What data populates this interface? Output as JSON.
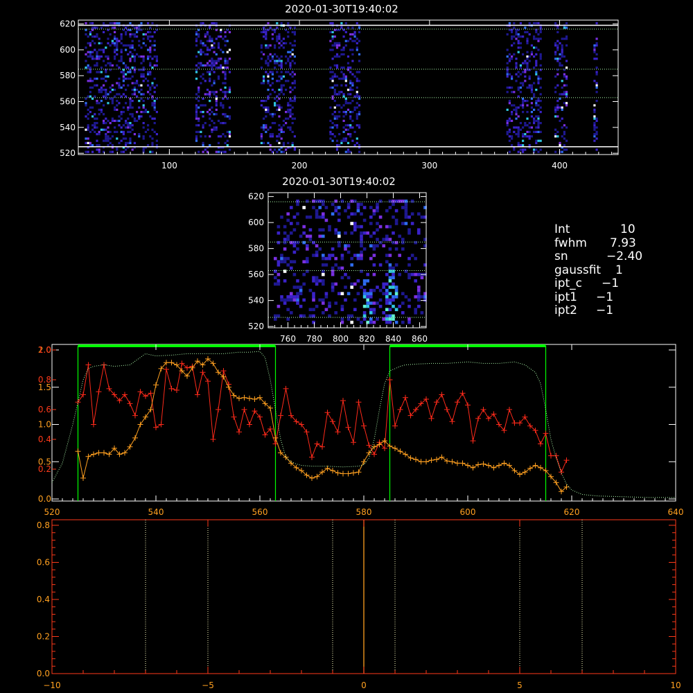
{
  "colors": {
    "background": "#000000",
    "axis_white": "#ffffff",
    "red_series": "#ff2a1a",
    "orange_series": "#ffa020",
    "green_box": "#00ff00",
    "dotted_profile": "#b0ffb0",
    "axis_red": "#ff3a1a",
    "axis_orange": "#ffa020",
    "vline_dotted": "#ffffc0",
    "center_line": "#ffa020"
  },
  "info": {
    "rows": [
      {
        "key": "Int",
        "value": "10"
      },
      {
        "key": "fwhm",
        "value": "7.93"
      },
      {
        "key": "sn",
        "value": "−2.40"
      },
      {
        "key": "gaussfit",
        "value": "1"
      },
      {
        "key": "ipt_c",
        "value": "−1"
      },
      {
        "key": "ipt1",
        "value": "−1"
      },
      {
        "key": "ipt2",
        "value": "−1"
      }
    ]
  },
  "chart_data": [
    {
      "type": "heatmap",
      "title": "2020-01-30T19:40:02",
      "xlim": [
        30,
        445
      ],
      "ylim": [
        519,
        623
      ],
      "x_ticks": [
        "100",
        "200",
        "300",
        "400"
      ],
      "x_tick_values": [
        100,
        200,
        300,
        400
      ],
      "y_ticks": [
        "520",
        "540",
        "560",
        "580",
        "600",
        "620"
      ],
      "y_tick_values": [
        520,
        540,
        560,
        580,
        600,
        620
      ],
      "horizontal_solid_lines": [
        525,
        619
      ],
      "horizontal_dotted_lines": [
        563,
        585,
        616
      ],
      "bright_bands_x": [
        [
          35,
          90
        ],
        [
          120,
          147
        ],
        [
          170,
          196
        ],
        [
          223,
          246
        ],
        [
          359,
          386
        ],
        [
          396,
          406
        ],
        [
          426,
          429
        ]
      ],
      "colormap": [
        "#1e1890",
        "#3a22c8",
        "#5a2ad8",
        "#7a30e0",
        "#2f6cf0",
        "#30c8e0",
        "#60f0d0",
        "#ffffff"
      ]
    },
    {
      "type": "heatmap",
      "title": "2020-01-30T19:40:02",
      "xlim": [
        745,
        865
      ],
      "ylim": [
        519,
        623
      ],
      "x_ticks": [
        "760",
        "780",
        "800",
        "820",
        "840",
        "860"
      ],
      "x_tick_values": [
        760,
        780,
        800,
        820,
        840,
        860
      ],
      "y_ticks": [
        "520",
        "540",
        "560",
        "580",
        "600",
        "620"
      ],
      "y_tick_values": [
        520,
        540,
        560,
        580,
        600,
        620
      ],
      "horizontal_dotted_lines": [
        527,
        563,
        585,
        616
      ],
      "bright_columns_x": [
        [
          815,
          822
        ],
        [
          833,
          842
        ]
      ],
      "colormap": [
        "#1e1890",
        "#3a22c8",
        "#5a2ad8",
        "#7a30e0",
        "#2f6cf0",
        "#30c8e0",
        "#60f0d0",
        "#ffffff"
      ]
    },
    {
      "type": "line",
      "xlim": [
        520,
        640
      ],
      "x_ticks": [
        "520",
        "540",
        "560",
        "580",
        "600",
        "620",
        "640"
      ],
      "x_tick_values": [
        520,
        540,
        560,
        580,
        600,
        620,
        640
      ],
      "left_axis_primary": {
        "ylim": [
          0,
          2.0
        ],
        "ticks": [
          "0.0",
          "0.5",
          "1.0",
          "1.5",
          "2.0"
        ],
        "values": [
          0.0,
          0.5,
          1.0,
          1.5,
          2.0
        ]
      },
      "left_axis_secondary": {
        "ylim": [
          0,
          1.0
        ],
        "ticks": [
          "0.2",
          "0.4",
          "0.6",
          "0.8",
          "1.0"
        ],
        "values": [
          0.2,
          0.4,
          0.6,
          0.8,
          1.0
        ]
      },
      "green_boxes": [
        [
          525,
          563
        ],
        [
          585,
          615
        ]
      ],
      "series": [
        {
          "name": "",
          "color": "red",
          "axis": "secondary",
          "x": [
            525,
            526,
            527,
            528,
            529,
            530,
            531,
            532,
            533,
            534,
            535,
            536,
            537,
            538,
            539,
            540,
            541,
            542,
            543,
            544,
            545,
            546,
            547,
            548,
            549,
            550,
            551,
            552,
            553,
            554,
            555,
            556,
            557,
            558,
            559,
            560,
            561,
            562,
            563,
            564,
            565,
            566,
            567,
            568,
            569,
            570,
            571,
            572,
            573,
            574,
            575,
            576,
            577,
            578,
            579,
            580,
            581,
            582,
            583,
            584,
            585,
            586,
            587,
            588,
            589,
            590,
            591,
            592,
            593,
            594,
            595,
            596,
            597,
            598,
            599,
            600,
            601,
            602,
            603,
            604,
            605,
            606,
            607,
            608,
            609,
            610,
            611,
            612,
            613,
            614,
            615,
            616,
            617,
            618,
            619
          ],
          "y": [
            0.65,
            0.7,
            0.9,
            0.5,
            0.72,
            0.9,
            0.74,
            0.7,
            0.66,
            0.7,
            0.64,
            0.56,
            0.72,
            0.69,
            0.71,
            0.48,
            0.5,
            0.87,
            0.74,
            0.73,
            0.91,
            0.88,
            0.89,
            0.7,
            0.85,
            0.79,
            0.4,
            0.6,
            0.86,
            0.77,
            0.55,
            0.45,
            0.6,
            0.5,
            0.59,
            0.55,
            0.43,
            0.47,
            0.37,
            0.56,
            0.74,
            0.56,
            0.52,
            0.5,
            0.45,
            0.28,
            0.37,
            0.35,
            0.58,
            0.52,
            0.45,
            0.66,
            0.48,
            0.38,
            0.65,
            0.49,
            0.36,
            0.3,
            0.38,
            0.34,
            0.8,
            0.49,
            0.6,
            0.68,
            0.56,
            0.6,
            0.64,
            0.67,
            0.54,
            0.65,
            0.7,
            0.6,
            0.52,
            0.65,
            0.71,
            0.63,
            0.39,
            0.54,
            0.6,
            0.54,
            0.57,
            0.5,
            0.46,
            0.6,
            0.51,
            0.51,
            0.55,
            0.49,
            0.46,
            0.37,
            0.44,
            0.29,
            0.29,
            0.18,
            0.26
          ],
          "marker": "+"
        },
        {
          "name": "",
          "color": "orange",
          "axis": "primary",
          "x": [
            525,
            526,
            527,
            528,
            529,
            530,
            531,
            532,
            533,
            534,
            535,
            536,
            537,
            538,
            539,
            540,
            541,
            542,
            543,
            544,
            545,
            546,
            547,
            548,
            549,
            550,
            551,
            552,
            553,
            554,
            555,
            556,
            557,
            558,
            559,
            560,
            561,
            562,
            563,
            564,
            565,
            566,
            567,
            568,
            569,
            570,
            571,
            572,
            573,
            574,
            575,
            576,
            577,
            578,
            579,
            580,
            581,
            582,
            583,
            584,
            585,
            586,
            587,
            588,
            589,
            590,
            591,
            592,
            593,
            594,
            595,
            596,
            597,
            598,
            599,
            600,
            601,
            602,
            603,
            604,
            605,
            606,
            607,
            608,
            609,
            610,
            611,
            612,
            613,
            614,
            615,
            616,
            617,
            618,
            619
          ],
          "y": [
            0.64,
            0.28,
            0.57,
            0.6,
            0.62,
            0.62,
            0.6,
            0.68,
            0.6,
            0.62,
            0.7,
            0.82,
            1.0,
            1.1,
            1.2,
            1.53,
            1.75,
            1.83,
            1.83,
            1.8,
            1.72,
            1.65,
            1.76,
            1.85,
            1.8,
            1.88,
            1.82,
            1.7,
            1.64,
            1.5,
            1.39,
            1.35,
            1.36,
            1.35,
            1.34,
            1.36,
            1.28,
            1.22,
            0.82,
            0.62,
            0.56,
            0.48,
            0.42,
            0.38,
            0.32,
            0.28,
            0.3,
            0.36,
            0.41,
            0.38,
            0.35,
            0.34,
            0.34,
            0.35,
            0.36,
            0.5,
            0.62,
            0.7,
            0.73,
            0.78,
            0.71,
            0.68,
            0.64,
            0.6,
            0.55,
            0.53,
            0.5,
            0.5,
            0.52,
            0.53,
            0.56,
            0.51,
            0.5,
            0.48,
            0.48,
            0.45,
            0.42,
            0.46,
            0.47,
            0.45,
            0.42,
            0.45,
            0.48,
            0.45,
            0.38,
            0.33,
            0.36,
            0.41,
            0.45,
            0.42,
            0.38,
            0.3,
            0.22,
            0.1,
            0.16
          ],
          "marker": "+"
        },
        {
          "name": "",
          "color": "white-dotted",
          "axis": "primary",
          "x": [
            520,
            522,
            524,
            525,
            526,
            527,
            528,
            530,
            532,
            535,
            538,
            540,
            543,
            546,
            550,
            553,
            556,
            558,
            560,
            561,
            562,
            563,
            564,
            565,
            566,
            567,
            568,
            570,
            573,
            576,
            579,
            580,
            581,
            582,
            583,
            584,
            585,
            586,
            587,
            588,
            590,
            593,
            596,
            600,
            603,
            606,
            609,
            611,
            613,
            614,
            615,
            616,
            617,
            618,
            619,
            620,
            622,
            625,
            630,
            635,
            640
          ],
          "y": [
            0.22,
            0.48,
            1.0,
            1.3,
            1.6,
            1.75,
            1.78,
            1.8,
            1.78,
            1.8,
            1.95,
            1.92,
            1.93,
            1.95,
            1.95,
            1.95,
            1.97,
            1.97,
            1.98,
            1.9,
            1.6,
            1.2,
            0.8,
            0.56,
            0.5,
            0.47,
            0.45,
            0.44,
            0.44,
            0.43,
            0.44,
            0.46,
            0.55,
            0.8,
            1.2,
            1.55,
            1.72,
            1.75,
            1.78,
            1.8,
            1.81,
            1.82,
            1.82,
            1.84,
            1.82,
            1.82,
            1.84,
            1.8,
            1.7,
            1.55,
            1.2,
            0.8,
            0.55,
            0.35,
            0.2,
            0.12,
            0.06,
            0.04,
            0.03,
            0.02,
            0.02
          ]
        }
      ]
    },
    {
      "type": "line",
      "xlim": [
        -10,
        10
      ],
      "ylim": [
        0,
        0.8
      ],
      "x_ticks": [
        "−10",
        "−5",
        "0",
        "5",
        "10"
      ],
      "x_tick_values": [
        -10,
        -5,
        0,
        5,
        10
      ],
      "y_ticks": [
        "0.0",
        "0.2",
        "0.4",
        "0.6",
        "0.8"
      ],
      "y_tick_values": [
        0.0,
        0.2,
        0.4,
        0.6,
        0.8
      ],
      "dotted_vlines": [
        -7,
        -5,
        -1,
        1,
        5,
        7
      ],
      "solid_vlines": [
        0
      ]
    }
  ]
}
